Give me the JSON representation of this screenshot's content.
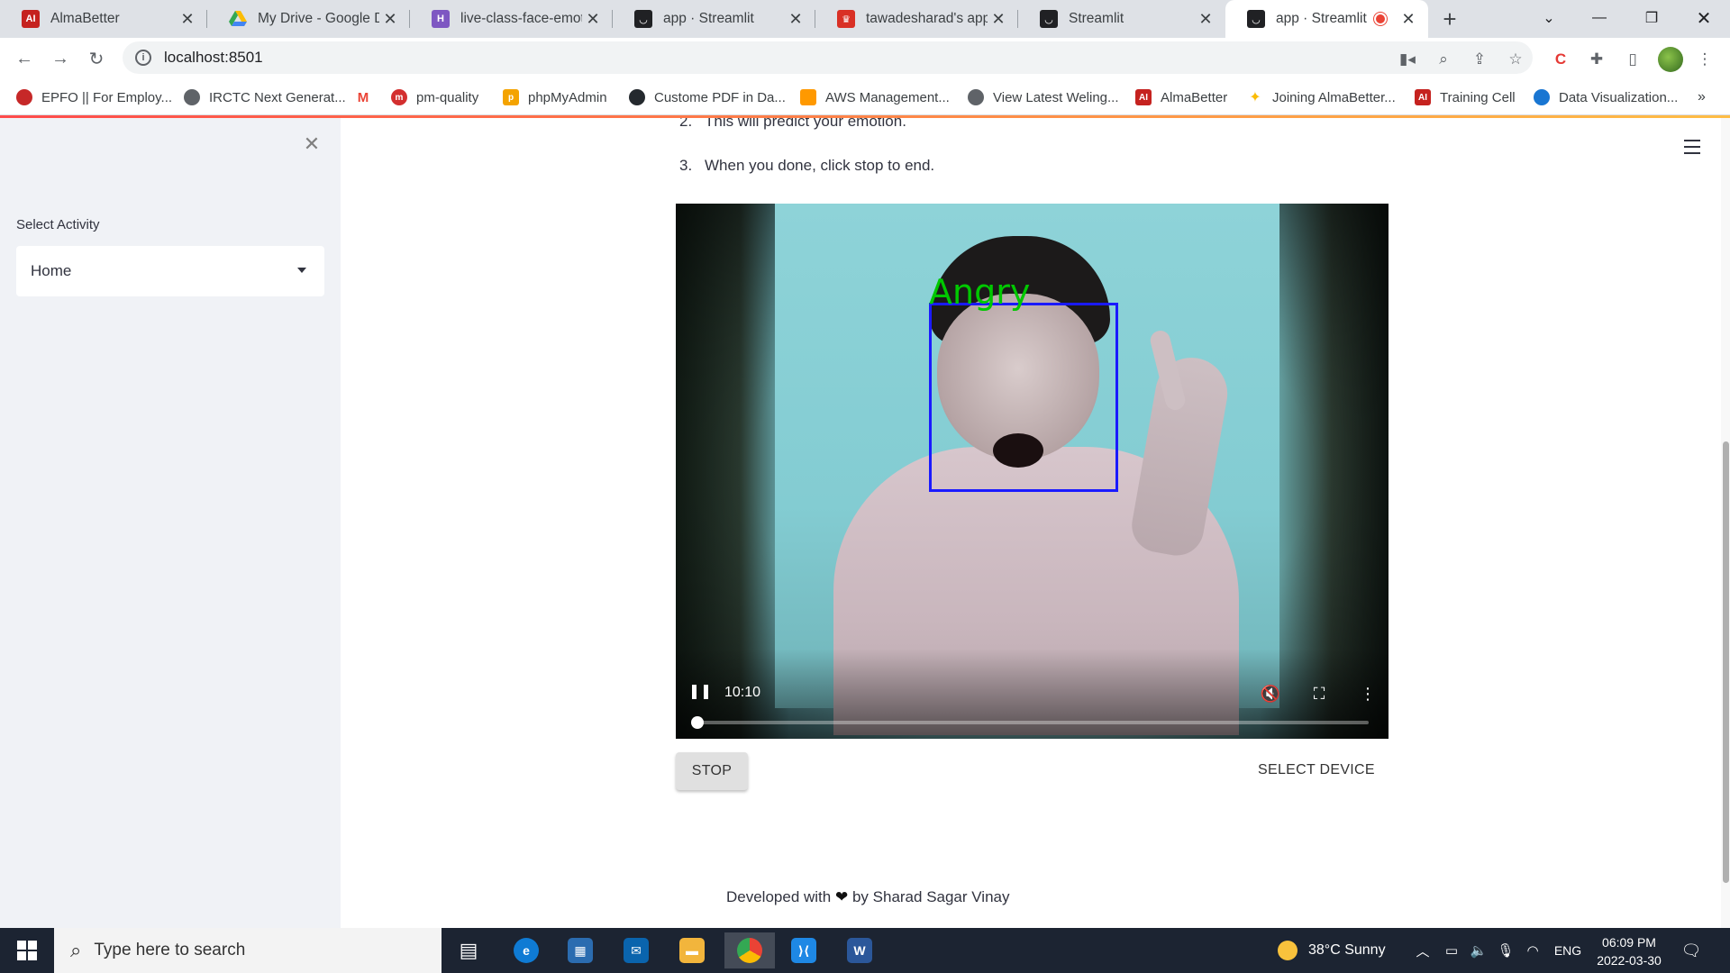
{
  "browser": {
    "tabs": [
      {
        "label": "AlmaBetter",
        "icon": "almabetter-favicon"
      },
      {
        "label": "My Drive - Google Dri",
        "icon": "google-drive-favicon"
      },
      {
        "label": "live-class-face-emotic",
        "icon": "heroku-favicon"
      },
      {
        "label": "app · Streamlit",
        "icon": "streamlit-favicon"
      },
      {
        "label": "tawadesharad's apps",
        "icon": "streamlit-red-favicon"
      },
      {
        "label": "Streamlit",
        "icon": "streamlit-favicon"
      },
      {
        "label": "app · Streamlit",
        "icon": "streamlit-favicon",
        "active": true,
        "recording": true
      }
    ],
    "url": "localhost:8501",
    "bookmarks": [
      {
        "label": "EPFO || For Employ..."
      },
      {
        "label": "IRCTC Next Generat..."
      },
      {
        "label": "pm-quality"
      },
      {
        "label": "phpMyAdmin"
      },
      {
        "label": "Custome PDF in Da..."
      },
      {
        "label": "AWS Management..."
      },
      {
        "label": "View Latest Weling..."
      },
      {
        "label": "AlmaBetter"
      },
      {
        "label": "Joining AlmaBetter..."
      },
      {
        "label": "Training Cell"
      },
      {
        "label": "Data Visualization..."
      }
    ]
  },
  "sidebar": {
    "select_label": "Select Activity",
    "select_value": "Home"
  },
  "main": {
    "steps": [
      {
        "num": "2.",
        "text": "This will predict your emotion."
      },
      {
        "num": "3.",
        "text": "When you done, click stop to end."
      }
    ],
    "video": {
      "emotion_label": "Angry",
      "time": "10:10",
      "progress": 0.0
    },
    "stop_label": "STOP",
    "select_device_label": "SELECT DEVICE",
    "footer_pre": "Developed with",
    "footer_post": "by Sharad Sagar Vinay"
  },
  "taskbar": {
    "search_placeholder": "Type here to search",
    "weather": "38°C  Sunny",
    "language": "ENG",
    "time": "06:09 PM",
    "date": "2022-03-30"
  },
  "colors": {
    "face_box": "#1a1aff",
    "emotion_text": "#00c800",
    "sidebar_bg": "#f0f2f6",
    "streamlit_accent": "#ff4b4b"
  }
}
